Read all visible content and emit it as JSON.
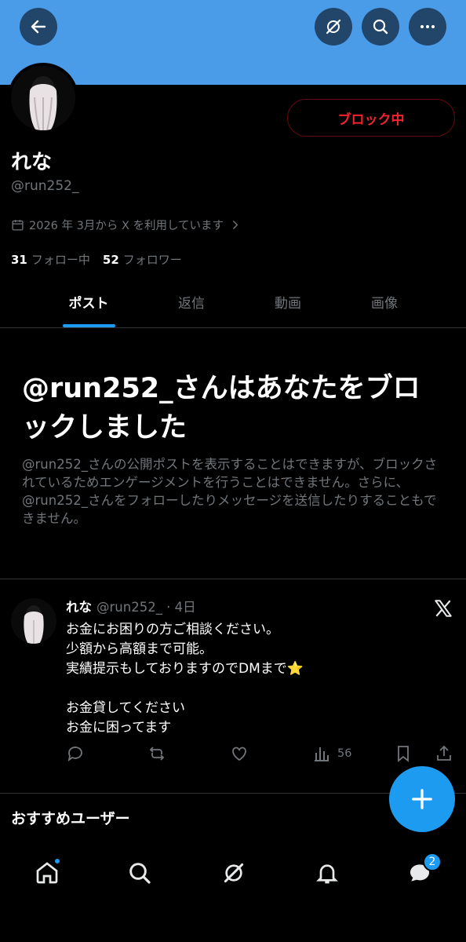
{
  "header": {
    "back_icon": "back-arrow-icon",
    "grok_icon": "grok-icon",
    "search_icon": "search-icon",
    "more_icon": "more-icon",
    "banner_color": "#4a9be8"
  },
  "profile": {
    "blocked_label": "ブロック中",
    "display_name": "れな",
    "handle": "@run252_",
    "joined": "2026 年 3月から X を利用しています",
    "following_count": "31",
    "following_label": "フォロー中",
    "followers_count": "52",
    "followers_label": "フォロワー"
  },
  "tabs": [
    {
      "label": "ポスト"
    },
    {
      "label": "返信"
    },
    {
      "label": "動画"
    },
    {
      "label": "画像"
    }
  ],
  "block_notice": {
    "title": "@run252_さんはあなたをブロックしました",
    "description": "@run252_さんの公開ポストを表示することはできますが、ブロックされているためエンゲージメントを行うことはできません。さらに、@run252_さんをフォローしたりメッセージを送信したりすることもできません。"
  },
  "post": {
    "name": "れな",
    "meta": "@run252_ · 4日",
    "lines": [
      "お金にお困りの方ご相談ください。",
      "少額から高額まで可能。",
      "実績提示もしておりますのでDMまで⭐",
      "",
      "お金貸してください",
      "お金に困ってます"
    ],
    "views": "56"
  },
  "recommended_title": "おすすめユーザー",
  "nav": {
    "messages_badge": "2"
  },
  "colors": {
    "accent": "#1d9bf0",
    "danger": "#f4212e"
  }
}
